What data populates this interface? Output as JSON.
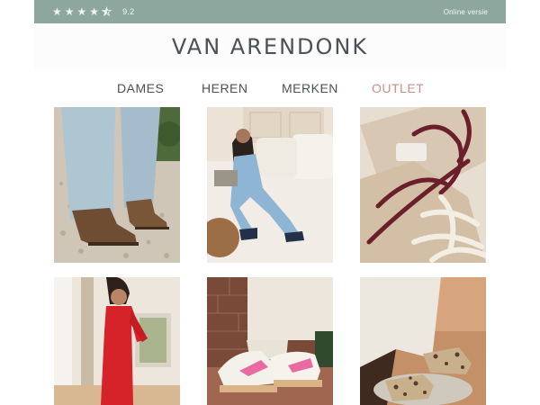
{
  "topbar": {
    "rating_score": "9.2",
    "rating_stars": 4.5,
    "online_label": "Online versie",
    "background_color": "#8ea79e"
  },
  "brand": {
    "logo_text": "VAN ARENDONK",
    "text_color": "#4a5157"
  },
  "nav": {
    "items": [
      {
        "label": "DAMES"
      },
      {
        "label": "HEREN"
      },
      {
        "label": "MERKEN"
      },
      {
        "label": "OUTLET",
        "color": "#c98f86"
      }
    ]
  },
  "tiles": [
    {
      "subject": "brown-suede-boots-with-jeans"
    },
    {
      "subject": "woman-on-sofa-in-denim"
    },
    {
      "subject": "sneakers-with-burgundy-laces"
    },
    {
      "subject": "woman-in-red-lace-dress"
    },
    {
      "subject": "white-pink-sneakers-on-brick"
    },
    {
      "subject": "leopard-print-loafers"
    }
  ]
}
